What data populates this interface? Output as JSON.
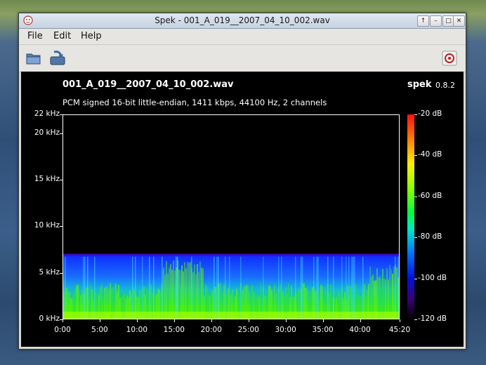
{
  "window": {
    "title": "Spek - 001_A_019__2007_04_10_002.wav",
    "controls": {
      "up": "↑",
      "minimize": "–",
      "maximize": "□",
      "close": "✕"
    }
  },
  "menu": {
    "file": "File",
    "edit": "Edit",
    "help": "Help"
  },
  "spectrogram": {
    "file_name": "001_A_019__2007_04_10_002.wav",
    "info": "PCM signed 16-bit little-endian, 1411 kbps, 44100 Hz, 2 channels",
    "brand": "spek",
    "version": "0.8.2"
  },
  "chart_data": {
    "type": "heatmap",
    "title": "001_A_019__2007_04_10_002.wav",
    "subtitle": "PCM signed 16-bit little-endian, 1411 kbps, 44100 Hz, 2 channels",
    "y_ticks": [
      "0 kHz",
      "5 kHz",
      "10 kHz",
      "15 kHz",
      "20 kHz",
      "22 kHz"
    ],
    "y_tick_values": [
      0,
      5,
      10,
      15,
      20,
      22
    ],
    "ylim": [
      0,
      22
    ],
    "x_ticks": [
      "0:00",
      "5:00",
      "10:00",
      "15:00",
      "20:00",
      "25:00",
      "30:00",
      "35:00",
      "40:00",
      "45:20"
    ],
    "x_tick_values": [
      0,
      5,
      10,
      15,
      20,
      25,
      30,
      35,
      40,
      45.333
    ],
    "xlim": [
      0,
      45.333
    ],
    "colorbar_ticks": [
      "-20 dB",
      "-40 dB",
      "-60 dB",
      "-80 dB",
      "-100 dB",
      "-120 dB"
    ],
    "colorbar_values": [
      -20,
      -40,
      -60,
      -80,
      -100,
      -120
    ],
    "signal_cutoff_khz": 7,
    "grid": false
  },
  "colors": {
    "background": "#000000",
    "text": "#ffffff",
    "titlebar": "#c6d3e1",
    "window": "#d8d8d4"
  }
}
